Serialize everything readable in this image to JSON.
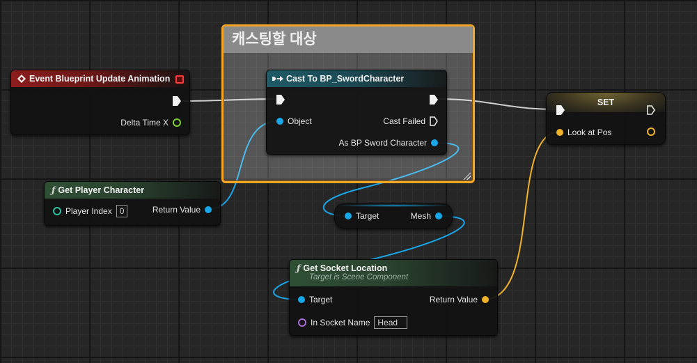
{
  "comment": {
    "title": "캐스팅할 대상"
  },
  "event_node": {
    "title": "Event Blueprint Update Animation",
    "pins": {
      "delta_time": "Delta Time X"
    }
  },
  "cast_node": {
    "title": "Cast To BP_SwordCharacter",
    "pins": {
      "object": "Object",
      "cast_failed": "Cast Failed",
      "as_character": "As BP Sword Character"
    }
  },
  "get_player_node": {
    "title": "Get Player Character",
    "pins": {
      "player_index": "Player Index",
      "player_index_value": "0",
      "return_value": "Return Value"
    }
  },
  "mesh_node": {
    "pins": {
      "target": "Target",
      "mesh": "Mesh"
    }
  },
  "socket_node": {
    "title": "Get Socket Location",
    "subtitle": "Target is Scene Component",
    "pins": {
      "target": "Target",
      "return_value": "Return Value",
      "socket_name": "In Socket Name",
      "socket_name_value": "Head"
    }
  },
  "set_node": {
    "title": "SET",
    "pins": {
      "look_at_pos": "Look at Pos"
    }
  },
  "colors": {
    "exec": "#e8e8e8",
    "object": "#18a7e8",
    "vector": "#f0b22a",
    "float": "#7bd132",
    "integer": "#2bc1a0",
    "name": "#a86bd6",
    "comment_border": "#f5a623"
  }
}
